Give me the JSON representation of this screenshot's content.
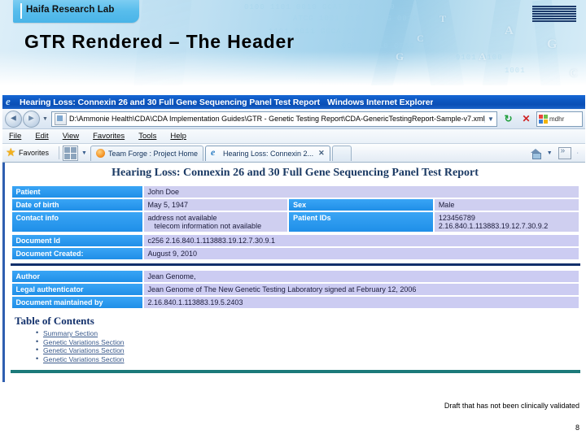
{
  "slide": {
    "tab_label": "Haifa Research Lab",
    "title": "GTR Rendered – The Header",
    "logo": "ibm-logo",
    "footer_note": "Draft that has not been clinically validated",
    "page_number": "8"
  },
  "browser": {
    "window_title": "Hearing Loss: Connexin 26 and 30 Full Gene Sequencing Panel Test Report",
    "window_app": "Windows Internet Explorer",
    "back_arrow": "◄",
    "forward_arrow": "►",
    "history_caret": "▼",
    "address": "D:\\Ammonie Health\\CDA\\CDA Implementation Guides\\GTR - Genetic Testing Report\\CDA-GenericTestingReport-Sample-v7.xml",
    "address_caret": "▼",
    "refresh_icon": "↻",
    "stop_icon": "✕",
    "search_value": "mdhr",
    "menu": [
      "File",
      "Edit",
      "View",
      "Favorites",
      "Tools",
      "Help"
    ],
    "favorites_label": "Favorites",
    "tabs": [
      {
        "title": "Team Forge : Project Home",
        "icon": "teamforge-icon",
        "active": false
      },
      {
        "title": "Hearing Loss: Connexin 2...",
        "icon": "ie-icon",
        "active": true,
        "close": "✕"
      }
    ],
    "new_tab_label": "",
    "home_icon": "home-icon",
    "rss_icon": "rss-feed-icon",
    "toolbar_caret": "▼"
  },
  "document": {
    "title": "Hearing Loss: Connexin 26 and 30 Full Gene Sequencing Panel Test Report",
    "rows": [
      {
        "left_label": "Patient",
        "left_value": "John Doe",
        "right_label": "",
        "right_value": ""
      },
      {
        "left_label": "Date of birth",
        "left_value": "May 5, 1947",
        "right_label": "Sex",
        "right_value": "Male"
      },
      {
        "left_label": "Contact info",
        "left_value": "address not available",
        "left_value_2": "telecom information not available",
        "right_label": "Patient IDs",
        "right_value": "123456789 2.16.840.1.113883.19.12.7.30.9.2"
      }
    ],
    "doc_rows": [
      {
        "label": "Document Id",
        "value": "c256 2.16.840.1.113883.19.12.7.30.9.1"
      },
      {
        "label": "Document Created:",
        "value": "August 9, 2010"
      }
    ],
    "author_rows": [
      {
        "label": "Author",
        "value": "Jean Genome,"
      },
      {
        "label": "Legal authenticator",
        "value": "Jean Genome of The New Genetic Testing Laboratory signed at February 12, 2006"
      },
      {
        "label": "Document maintained by",
        "value": "2.16.840.1.113883.19.5.2403"
      }
    ],
    "toc_heading": "Table of Contents",
    "toc_items": [
      "Summary Section",
      "Genetic Variations Section",
      "Genetic Variations Section",
      "Genetic Variations Section"
    ]
  }
}
